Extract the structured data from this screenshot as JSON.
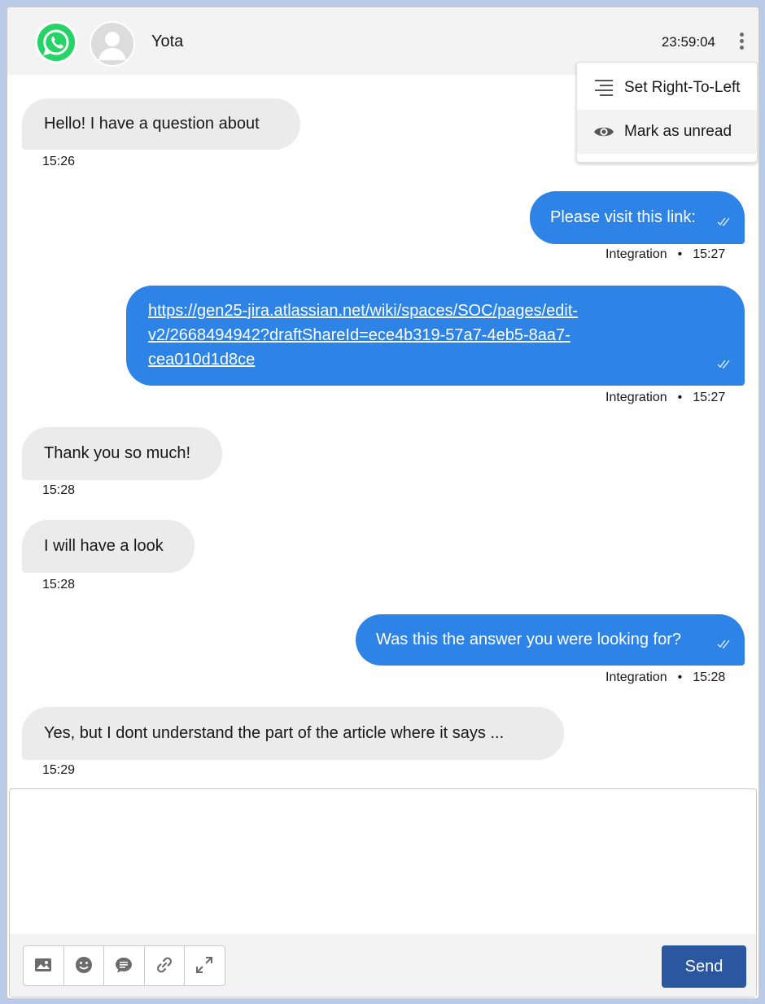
{
  "header": {
    "contact_name": "Yota",
    "time": "23:59:04",
    "channel_icon": "whatsapp-icon",
    "avatar_icon": "user-avatar-icon",
    "menu_icon": "kebab-menu-icon"
  },
  "menu": {
    "items": [
      {
        "label": "Set Right-To-Left",
        "icon": "align-right-icon"
      },
      {
        "label": "Mark as unread",
        "icon": "eye-icon"
      }
    ]
  },
  "messages": [
    {
      "direction": "in",
      "text": "Hello! I have a question about",
      "time": "15:26"
    },
    {
      "direction": "out",
      "text": "Please visit this link:",
      "sender": "Integration",
      "time": "15:27"
    },
    {
      "direction": "out",
      "link_lines": [
        "https://gen25-jira.atlassian.net/wiki/spaces/SOC/pages/edit-",
        "v2/2668494942?draftShareId=ece4b319-57a7-4eb5-8aa7-",
        "cea010d1d8ce"
      ],
      "sender": "Integration",
      "time": "15:27"
    },
    {
      "direction": "in",
      "text": "Thank you so much!",
      "time": "15:28"
    },
    {
      "direction": "in",
      "text": "I will have a look",
      "time": "15:28"
    },
    {
      "direction": "out",
      "text": "Was this the answer you were looking for?",
      "sender": "Integration",
      "time": "15:28"
    },
    {
      "direction": "in",
      "text": "Yes, but I dont understand the part of the article where it says ...",
      "time": "15:29"
    }
  ],
  "meta_separator": "•",
  "composer": {
    "placeholder": "",
    "tools": [
      "image-icon",
      "emoji-icon",
      "quick-text-icon",
      "link-icon",
      "expand-icon"
    ],
    "send_label": "Send"
  },
  "colors": {
    "outgoing_bubble": "#2e84e6",
    "incoming_bubble": "#ebebeb",
    "send_button": "#2a579f",
    "whatsapp_green": "#25d366"
  }
}
